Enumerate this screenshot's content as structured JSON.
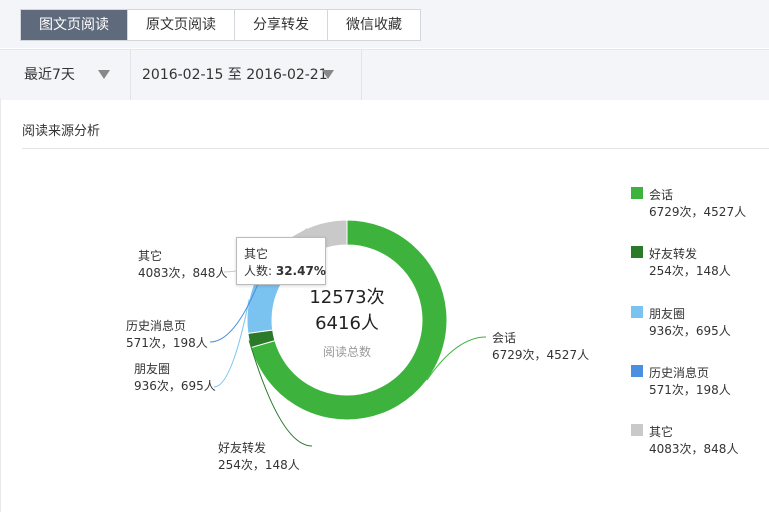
{
  "tabs": [
    {
      "label": "图文页阅读",
      "active": true
    },
    {
      "label": "原文页阅读",
      "active": false
    },
    {
      "label": "分享转发",
      "active": false
    },
    {
      "label": "微信收藏",
      "active": false
    }
  ],
  "filters": {
    "period": "最近7天",
    "date_range": "2016-02-15 至 2016-02-21"
  },
  "section_title": "阅读来源分析",
  "center": {
    "total_times": "12573次",
    "total_people": "6416人",
    "caption": "阅读总数"
  },
  "tooltip": {
    "name": "其它",
    "label": "人数: ",
    "value": "32.47%"
  },
  "colors": {
    "active_tab": "#5f6b7d",
    "tab_bar_bg": "#f4f5f9"
  },
  "chart_data": {
    "type": "pie",
    "donut": true,
    "slice_values": "people",
    "series": [
      {
        "name": "会话",
        "times": 6729,
        "people": 4527,
        "color": "#3db33d",
        "label": "6729次，4527人"
      },
      {
        "name": "好友转发",
        "times": 254,
        "people": 148,
        "color": "#2a7a2a",
        "label": "254次，148人"
      },
      {
        "name": "朋友圈",
        "times": 936,
        "people": 695,
        "color": "#7ac3f0",
        "label": "936次，695人"
      },
      {
        "name": "历史消息页",
        "times": 571,
        "people": 198,
        "color": "#4a8fe0",
        "label": "571次，198人"
      },
      {
        "name": "其它",
        "times": 4083,
        "people": 848,
        "color": "#c9c9c9",
        "label": "4083次，848人"
      }
    ],
    "legend_position": "right"
  }
}
